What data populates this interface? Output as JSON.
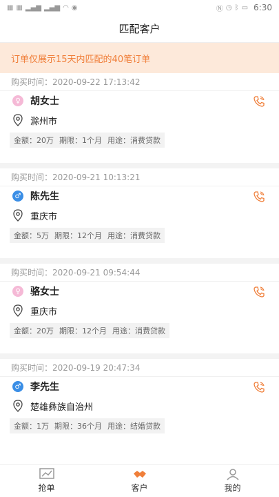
{
  "status_bar": {
    "time": "6:30",
    "battery": "▭"
  },
  "header": {
    "title": "匹配客户"
  },
  "notice": {
    "text": "订单仅展示15天内匹配的40笔订单"
  },
  "orders": [
    {
      "time_label": "购买时间：",
      "time": "2020-09-22 17:13:42",
      "gender": "female",
      "name": "胡女士",
      "city": "滁州市",
      "amount_label": "金额：",
      "amount": "20万",
      "term_label": "期限：",
      "term": "1个月",
      "purpose_label": "用途：",
      "purpose": "消费贷款"
    },
    {
      "time_label": "购买时间：",
      "time": "2020-09-21 10:13:21",
      "gender": "male",
      "name": "陈先生",
      "city": "重庆市",
      "amount_label": "金额：",
      "amount": "5万",
      "term_label": "期限：",
      "term": "12个月",
      "purpose_label": "用途：",
      "purpose": "消费贷款"
    },
    {
      "time_label": "购买时间：",
      "time": "2020-09-21 09:54:44",
      "gender": "female",
      "name": "骆女士",
      "city": "重庆市",
      "amount_label": "金额：",
      "amount": "20万",
      "term_label": "期限：",
      "term": "12个月",
      "purpose_label": "用途：",
      "purpose": "消费贷款"
    },
    {
      "time_label": "购买时间：",
      "time": "2020-09-19 20:47:34",
      "gender": "male",
      "name": "李先生",
      "city": "楚雄彝族自治州",
      "amount_label": "金额：",
      "amount": "1万",
      "term_label": "期限：",
      "term": "36个月",
      "purpose_label": "用途：",
      "purpose": "结婚贷款"
    }
  ],
  "bottom_nav": [
    {
      "label": "抢单",
      "icon": "chart-icon"
    },
    {
      "label": "客户",
      "icon": "handshake-icon"
    },
    {
      "label": "我的",
      "icon": "user-icon"
    }
  ],
  "colors": {
    "accent": "#f07f3a",
    "notice_bg": "#fde9da",
    "male": "#3a8ee6",
    "female": "#f5b9d6"
  }
}
